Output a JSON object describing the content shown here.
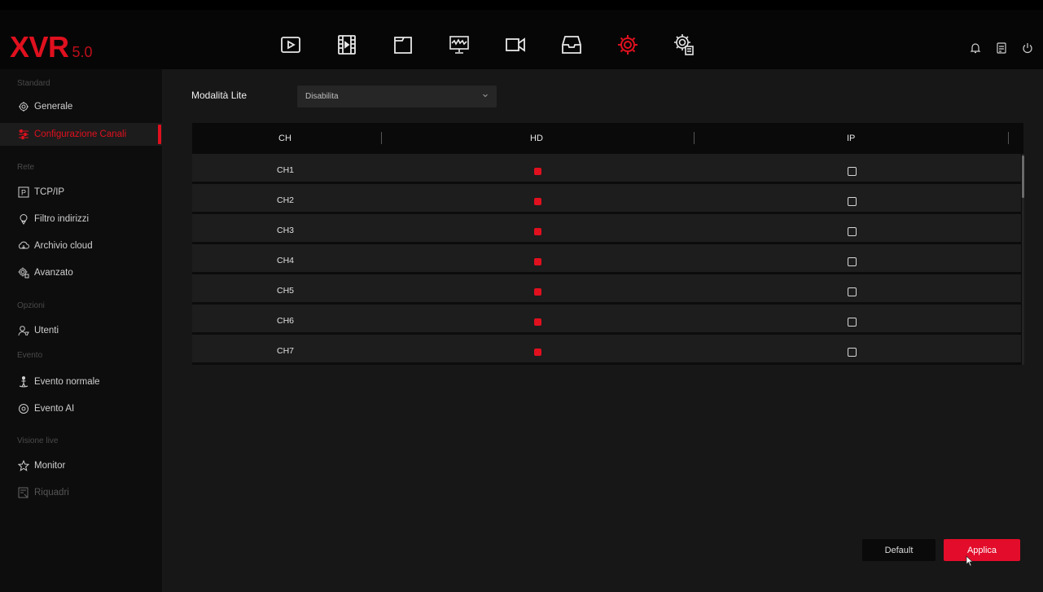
{
  "app": {
    "logo_main": "XVR",
    "logo_version": "5.0"
  },
  "topnav": {
    "items": [
      {
        "icon": "playback-icon"
      },
      {
        "icon": "video-clip-icon"
      },
      {
        "icon": "file-folder-icon"
      },
      {
        "icon": "network-monitor-icon"
      },
      {
        "icon": "camera-icon"
      },
      {
        "icon": "backup-tray-icon"
      },
      {
        "icon": "settings-gear-icon",
        "active": true
      },
      {
        "icon": "system-maintenance-icon"
      }
    ]
  },
  "top_right": {
    "icons": [
      "bell-icon",
      "storage-icon",
      "power-icon"
    ]
  },
  "sidebar": {
    "sections": {
      "standard": "Standard",
      "rete": "Rete",
      "opzioni": "Opzioni",
      "evento": "Evento",
      "visione_live": "Visione live"
    },
    "items": {
      "generale": "Generale",
      "configurazione_canali": "Configurazione Canali",
      "tcpip": "TCP/IP",
      "filtro_indirizzi": "Filtro indirizzi",
      "archivio_cloud": "Archivio cloud",
      "avanzato": "Avanzato",
      "utenti": "Utenti",
      "evento_normale": "Evento normale",
      "evento_ai": "Evento AI",
      "monitor": "Monitor",
      "riquadri": "Riquadri"
    }
  },
  "main": {
    "lite_mode": {
      "label": "Modalità Lite",
      "value": "Disabilita"
    },
    "table": {
      "headers": {
        "ch": "CH",
        "hd": "HD",
        "ip": "IP"
      },
      "rows": [
        {
          "ch": "CH1",
          "hd": true,
          "ip": false
        },
        {
          "ch": "CH2",
          "hd": true,
          "ip": false
        },
        {
          "ch": "CH3",
          "hd": true,
          "ip": false
        },
        {
          "ch": "CH4",
          "hd": true,
          "ip": false
        },
        {
          "ch": "CH5",
          "hd": true,
          "ip": false
        },
        {
          "ch": "CH6",
          "hd": true,
          "ip": false
        },
        {
          "ch": "CH7",
          "hd": true,
          "ip": false
        }
      ]
    },
    "buttons": {
      "default": "Default",
      "apply": "Applica"
    }
  },
  "colors": {
    "accent": "#e0101e",
    "apply_button": "#e30c2a"
  }
}
